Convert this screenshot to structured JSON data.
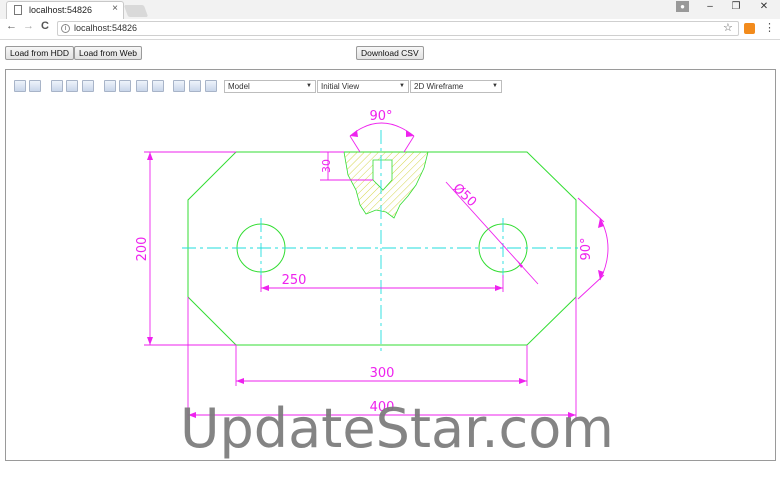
{
  "browser": {
    "tab_title": "localhost:54826",
    "tab_close": "×",
    "url": "localhost:54826",
    "window_buttons": {
      "minimize": "–",
      "maximize": "❐",
      "close": "✕"
    },
    "nav": {
      "back": "←",
      "forward": "→",
      "reload": "C",
      "star": "☆",
      "menu": "⋮"
    }
  },
  "toolbar": {
    "load_hdd": "Load from HDD",
    "load_web": "Load from Web",
    "download_csv": "Download CSV"
  },
  "viewer_toolbar": {
    "icons": [
      "save-icon",
      "print-icon",
      "zoom-in-icon",
      "zoom-out-icon",
      "zoom-extents-icon",
      "zoom-window-icon",
      "fit-icon",
      "layers-icon",
      "select-icon",
      "measure-distance-icon",
      "measure-area-icon",
      "measure-angle-icon"
    ],
    "model_select": "Model",
    "view_select": "Initial View",
    "style_select": "2D Wireframe"
  },
  "drawing": {
    "dim_angle_top": "90°",
    "dim_height_notch": "30",
    "dim_diameter": "Ø50",
    "dim_height": "200",
    "dim_angle_right": "90°",
    "dim_hole_spacing": "250",
    "dim_bottom_width": "300",
    "dim_total_width": "400",
    "colors": {
      "outline": "#33dd33",
      "dimension": "#ee22ee",
      "centerline": "#22dddd",
      "hatch": "#dddd22"
    }
  },
  "watermark": "UpdateStar.com"
}
